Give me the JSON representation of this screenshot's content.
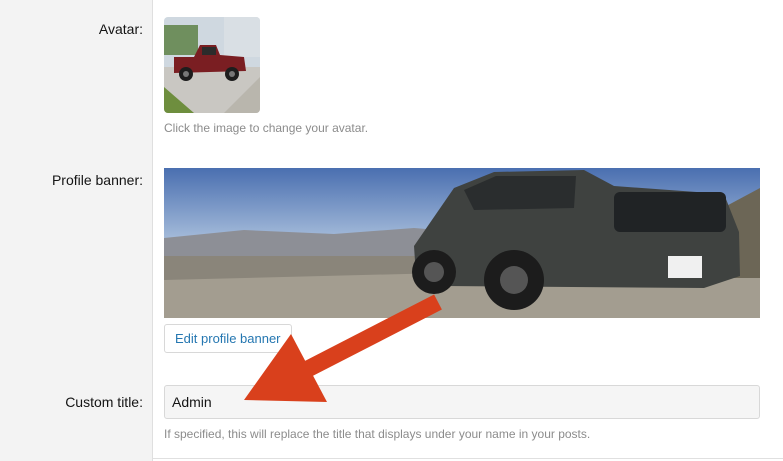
{
  "form": {
    "avatar": {
      "label": "Avatar:",
      "hint": "Click the image to change your avatar."
    },
    "banner": {
      "label": "Profile banner:",
      "edit_button": "Edit profile banner"
    },
    "custom_title": {
      "label": "Custom title:",
      "value": "Admin",
      "hint": "If specified, this will replace the title that displays under your name in your posts."
    }
  },
  "annotation": {
    "arrow_color": "#d9401c"
  },
  "colors": {
    "link": "#2577b1",
    "hint": "#8c8c8c",
    "label_column_bg": "#f3f3f3"
  }
}
